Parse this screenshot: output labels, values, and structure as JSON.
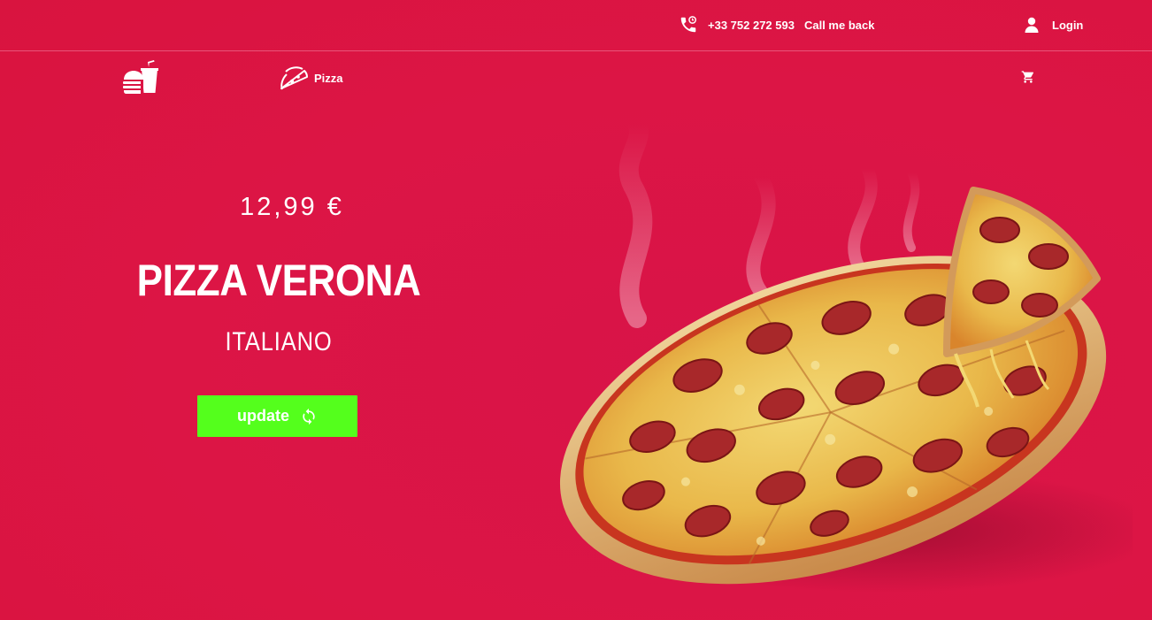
{
  "topbar": {
    "phone_icon": "phone-call-icon",
    "phone_number": "+33 752 272 593",
    "callback_label": "Call me back",
    "user_icon": "user-icon",
    "login_label": "Login"
  },
  "nav": {
    "logo_icon": "burger-drink-logo-icon",
    "pizza_icon": "pizza-slice-icon",
    "pizza_label": "Pizza",
    "cart_icon": "cart-icon"
  },
  "hero": {
    "price": "12,99 €",
    "title": "PIZZA VERONA",
    "subtitle": "ITALIANO",
    "update_label": "update",
    "refresh_icon": "refresh-icon",
    "image": "pepperoni-pizza-photo"
  },
  "colors": {
    "background": "#dc1545",
    "button": "#54ff1c",
    "text": "#ffffff"
  }
}
